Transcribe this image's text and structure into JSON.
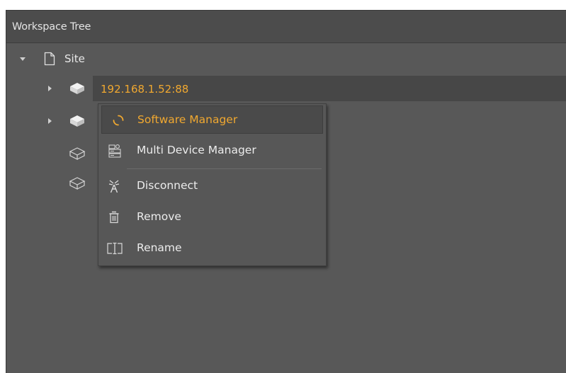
{
  "panel": {
    "title": "Workspace Tree"
  },
  "tree": {
    "root": {
      "label": "Site",
      "expanded": true
    },
    "nodes": [
      {
        "label": "192.168.1.52:88",
        "selected": true,
        "color": "#f0a830"
      }
    ]
  },
  "context_menu": {
    "items": [
      {
        "label": "Software Manager",
        "icon": "spinner-icon",
        "active": true
      },
      {
        "label": "Multi Device Manager",
        "icon": "devices-icon"
      },
      {
        "label": "Disconnect",
        "icon": "antenna-icon"
      },
      {
        "label": "Remove",
        "icon": "trash-icon"
      },
      {
        "label": "Rename",
        "icon": "rename-icon"
      }
    ]
  },
  "colors": {
    "accent": "#f0a830",
    "panel_bg": "#585858",
    "header_bg": "#4c4c4c"
  }
}
